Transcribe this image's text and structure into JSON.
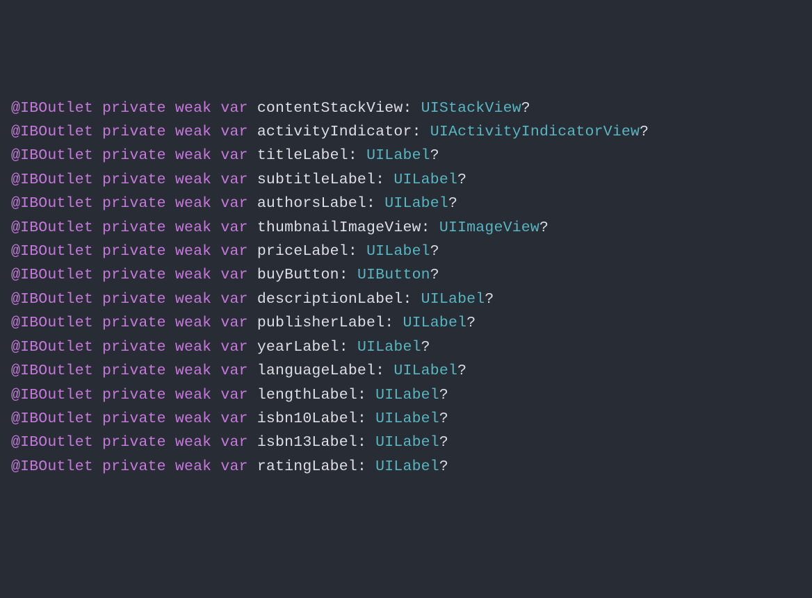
{
  "decls": [
    {
      "name": "contentStackView",
      "type": "UIStackView"
    },
    {
      "name": "activityIndicator",
      "type": "UIActivityIndicatorView"
    },
    {
      "name": "titleLabel",
      "type": "UILabel"
    },
    {
      "name": "subtitleLabel",
      "type": "UILabel"
    },
    {
      "name": "authorsLabel",
      "type": "UILabel"
    },
    {
      "name": "thumbnailImageView",
      "type": "UIImageView"
    },
    {
      "name": "priceLabel",
      "type": "UILabel"
    },
    {
      "name": "buyButton",
      "type": "UIButton"
    },
    {
      "name": "descriptionLabel",
      "type": "UILabel"
    },
    {
      "name": "publisherLabel",
      "type": "UILabel"
    },
    {
      "name": "yearLabel",
      "type": "UILabel"
    },
    {
      "name": "languageLabel",
      "type": "UILabel"
    },
    {
      "name": "lengthLabel",
      "type": "UILabel"
    },
    {
      "name": "isbn10Label",
      "type": "UILabel"
    },
    {
      "name": "isbn13Label",
      "type": "UILabel"
    },
    {
      "name": "ratingLabel",
      "type": "UILabel"
    }
  ],
  "tokens": {
    "attribute": "@IBOutlet",
    "access": "private",
    "weak": "weak",
    "var": "var",
    "colon": ":",
    "optional": "?"
  }
}
